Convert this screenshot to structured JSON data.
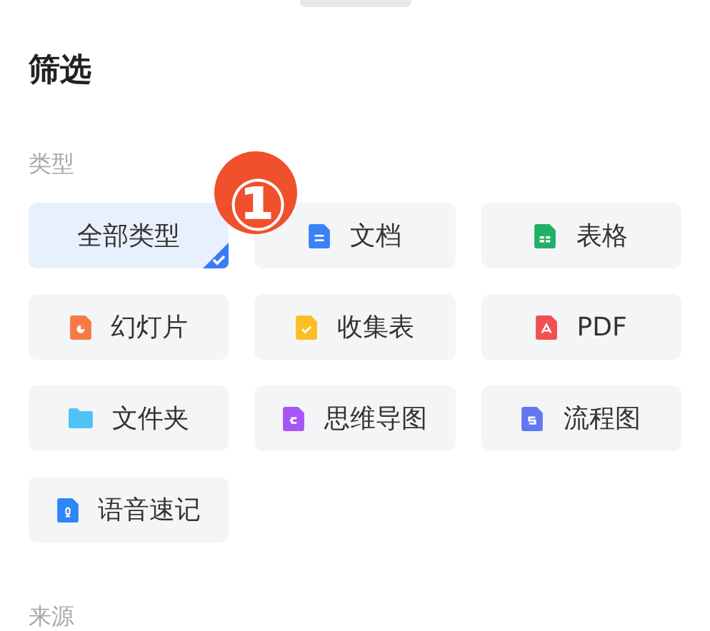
{
  "title": "筛选",
  "sections": [
    {
      "heading": "类型",
      "options": [
        {
          "label": "全部类型",
          "kind": "all",
          "selected": true
        },
        {
          "label": "文档",
          "kind": "doc",
          "selected": false
        },
        {
          "label": "表格",
          "kind": "sheet",
          "selected": false
        },
        {
          "label": "幻灯片",
          "kind": "slide",
          "selected": false
        },
        {
          "label": "收集表",
          "kind": "form",
          "selected": false
        },
        {
          "label": "PDF",
          "kind": "pdf",
          "selected": false
        },
        {
          "label": "文件夹",
          "kind": "folder",
          "selected": false
        },
        {
          "label": "思维导图",
          "kind": "mindmap",
          "selected": false
        },
        {
          "label": "流程图",
          "kind": "flowchart",
          "selected": false
        },
        {
          "label": "语音速记",
          "kind": "voice",
          "selected": false
        }
      ]
    },
    {
      "heading": "来源"
    }
  ],
  "annotation_marker": "①"
}
